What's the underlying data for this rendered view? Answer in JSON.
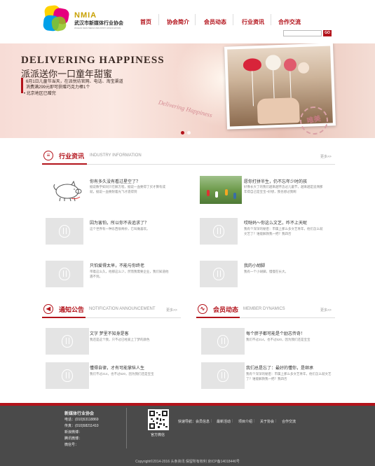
{
  "header": {
    "brand_en": "NMIA",
    "brand_cn": "武汉市新媒体行业协会",
    "brand_sub": "WUHAN NEW MEDIA INDUSTRY ASSOCIATION",
    "nav": [
      "首页",
      "协会简介",
      "会员动态",
      "行业资讯",
      "合作交流"
    ],
    "search_button": "GO",
    "colors": {
      "accent": "#b3131b"
    }
  },
  "banner": {
    "title": "DELIVERING HAPPINESS",
    "subtitle": "派派送你一口童年甜蜜",
    "line1": "6月1日儿童节当天，在派悦坊官网、电话、淘宝渠道",
    "line2": "消费满299元即可获赠巧克力棒1个",
    "line3": "• 北京地区已赠完",
    "script": "Delivering Happiness",
    "stamp": "唯美"
  },
  "industry": {
    "title": "行业资讯",
    "title_en": "INDUSTRY INFORMATION",
    "more": "更多>>",
    "items": [
      {
        "title": "你有多久没有看过星空了？",
        "desc": "据说数字如同只在解方程，据说一血要得了买才算有成就，据说一血要耐着光飞才遗得到"
      },
      {
        "title": "愿你打拼半生，仍不忘年少时的孩",
        "desc": "好像长大了的我们越来越怀念过儿童节，越来越是追溯那年得自己是宝宝~好想，我也想过我啊"
      },
      {
        "title": "因为害怕，所以你不去追求了？",
        "desc": "这个世界有一种东西很奇妙，它叫做喜欢。"
      },
      {
        "title": "哎呀妈～你这么文艺，咋不上天呢",
        "desc": "我有个深深的秘密：市属上那么多文艺青年，他们怎么就文艺了？谁能解救我一把？我四否"
      },
      {
        "title": "只怕爱得太早，不能与你终老",
        "desc": "带着这么久，他那这么少，然而我需要企业，我们知道他遇不到。"
      },
      {
        "title": "我的小胡脚",
        "desc": "我有一个小胡脚，慢慢在长大。"
      }
    ]
  },
  "notice": {
    "title": "通知公告",
    "title_en": "NOTIFICATION ANNOUNCEMENT",
    "more": "更多>>",
    "items": [
      {
        "title": "文字 梦里不知身是客",
        "desc": "我还是这个我，只不过已经爱上了梦的颜色"
      },
      {
        "title": "懂得自律，才有可能掌纵人生",
        "desc": "我们不过214，也不过520，因为我们还是宝宝"
      }
    ]
  },
  "members": {
    "title": "会员动态",
    "title_en": "MEMBER DYNAMICS",
    "more": "更多>>",
    "items": [
      {
        "title": "每个胖子都可能是个励志传奇！",
        "desc": "我们不过214，也不过520，因为我们还是宝宝"
      },
      {
        "title": "我们总是忘了：最好的懂你，是继承",
        "desc": "我有个深深的秘密：市属上那么多文艺青年，他们怎么就文艺了？谁能解救我一把？我四否"
      }
    ]
  },
  "footer": {
    "org": "新媒体行业协会",
    "phone": "电话：(010)53118869",
    "fax": "传真：(010)58211410",
    "weibo": "新浪微博：",
    "tweibo": "腾讯微博：",
    "wechat": "微信号：",
    "qr_label": "官方微信",
    "quick_nav_label": "快速导航：",
    "quick_nav": [
      "会员信息",
      "最新活动",
      "项目介绍",
      "关于协会",
      "合作交流"
    ],
    "copyright": "Copyright©2014-2016 头条资讯 保留所有权利 京ICP备14018446号"
  }
}
